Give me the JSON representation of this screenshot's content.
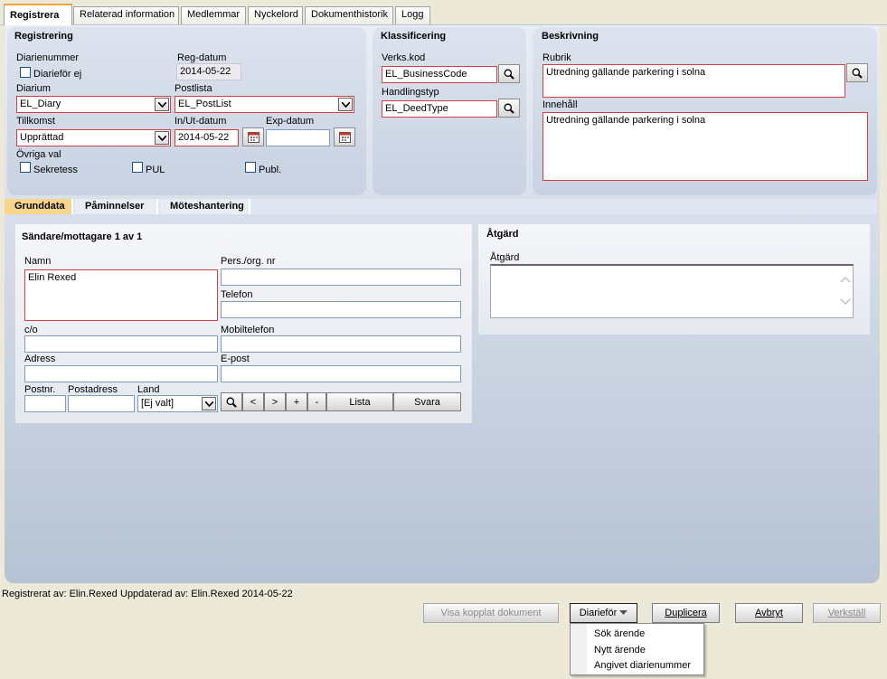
{
  "tabs": [
    "Registrera",
    "Relaterad information",
    "Medlemmar",
    "Nyckelord",
    "Dokumenthistorik",
    "Logg"
  ],
  "registrering": {
    "title": "Registrering",
    "diarienummer_label": "Diarienummer",
    "diarifor_ej_label": "Diarieför ej",
    "reg_datum_label": "Reg-datum",
    "reg_datum_value": "2014-05-22",
    "diarium_label": "Diarium",
    "diarium_value": "EL_Diary",
    "postlista_label": "Postlista",
    "postlista_value": "EL_PostList",
    "tillkomst_label": "Tillkomst",
    "tillkomst_value": "Upprättad",
    "in_ut_datum_label": "In/Ut-datum",
    "in_ut_datum_value": "2014-05-22",
    "exp_datum_label": "Exp-datum",
    "exp_datum_value": "",
    "ovriga_val_label": "Övriga val",
    "sekretess_label": "Sekretess",
    "pul_label": "PUL",
    "publ_label": "Publ."
  },
  "klassificering": {
    "title": "Klassificering",
    "verks_kod_label": "Verks.kod",
    "verks_kod_value": "EL_BusinessCode",
    "handlingstyp_label": "Handlingstyp",
    "handlingstyp_value": "EL_DeedType"
  },
  "beskrivning": {
    "title": "Beskrivning",
    "rubrik_label": "Rubrik",
    "rubrik_value": "Utredning gällande parkering i solna",
    "innehall_label": "Innehåll",
    "innehall_value": "Utredning gällande parkering i solna"
  },
  "subtabs": [
    "Grunddata",
    "Påminnelser",
    "Möteshantering"
  ],
  "sandare": {
    "title": "Sändare/mottagare 1 av 1",
    "namn_label": "Namn",
    "namn_value": "Elin Rexed",
    "pers_org_label": "Pers./org. nr",
    "telefon_label": "Telefon",
    "co_label": "c/o",
    "mobiltelefon_label": "Mobiltelefon",
    "adress_label": "Adress",
    "epost_label": "E-post",
    "postnr_label": "Postnr.",
    "postadress_label": "Postadress",
    "land_label": "Land",
    "land_value": "[Ej valt]",
    "nav_prev": "<",
    "nav_next": ">",
    "nav_add": "+",
    "nav_remove": "-",
    "lista_label": "Lista",
    "svara_label": "Svara"
  },
  "atgard": {
    "title": "Åtgärd",
    "label": "Åtgärd"
  },
  "status": {
    "registrerat_av": "Registrerat av: Elin.Rexed",
    "uppdaterad_av": "Uppdaterad av: Elin.Rexed 2014-05-22"
  },
  "buttons": {
    "visa_kopplat": "Visa kopplat dokument",
    "diarifor": "Diarieför",
    "duplicera": "Duplicera",
    "avbryt": "Avbryt",
    "verkstall": "Verkställ"
  },
  "dropdown_menu": [
    "Sök ärende",
    "Nytt ärende",
    "Angivet diarienummer"
  ]
}
